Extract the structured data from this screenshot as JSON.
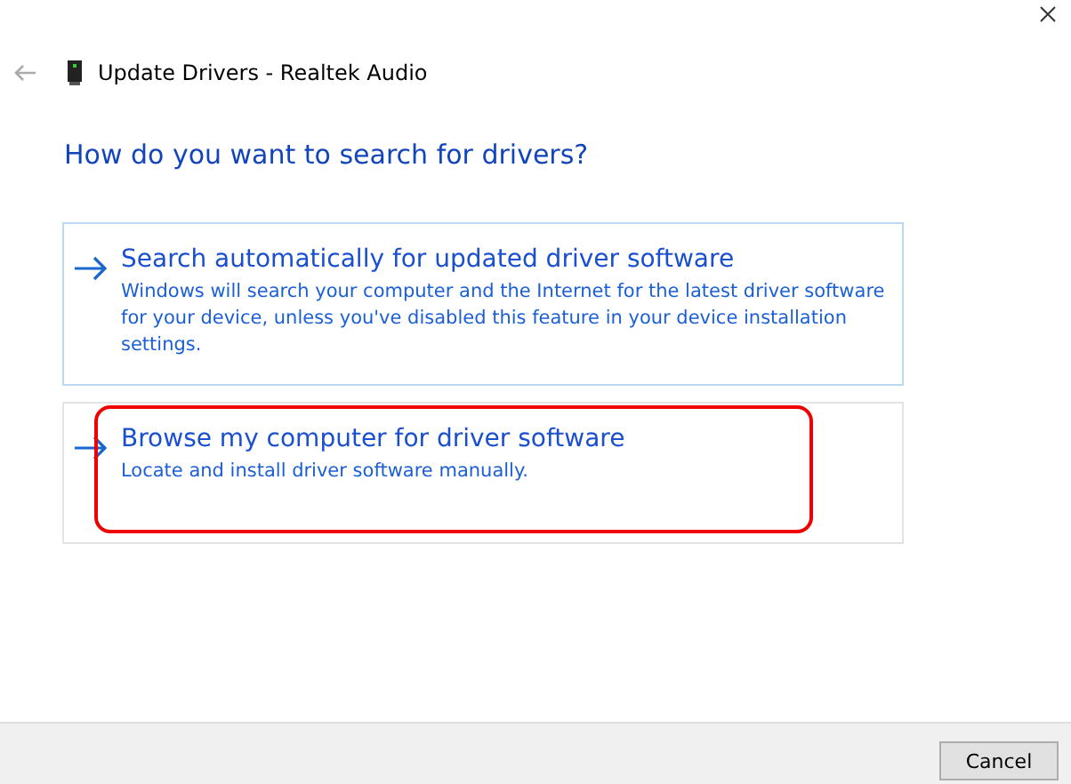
{
  "window": {
    "title": "Update Drivers - Realtek Audio"
  },
  "heading": "How do you want to search for drivers?",
  "options": [
    {
      "title": "Search automatically for updated driver software",
      "description": "Windows will search your computer and the Internet for the latest driver software for your device, unless you've disabled this feature in your device installation settings.",
      "highlighted": true,
      "circled": false
    },
    {
      "title": "Browse my computer for driver software",
      "description": "Locate and install driver software manually.",
      "highlighted": false,
      "circled": true
    }
  ],
  "buttons": [
    "Cancel"
  ]
}
